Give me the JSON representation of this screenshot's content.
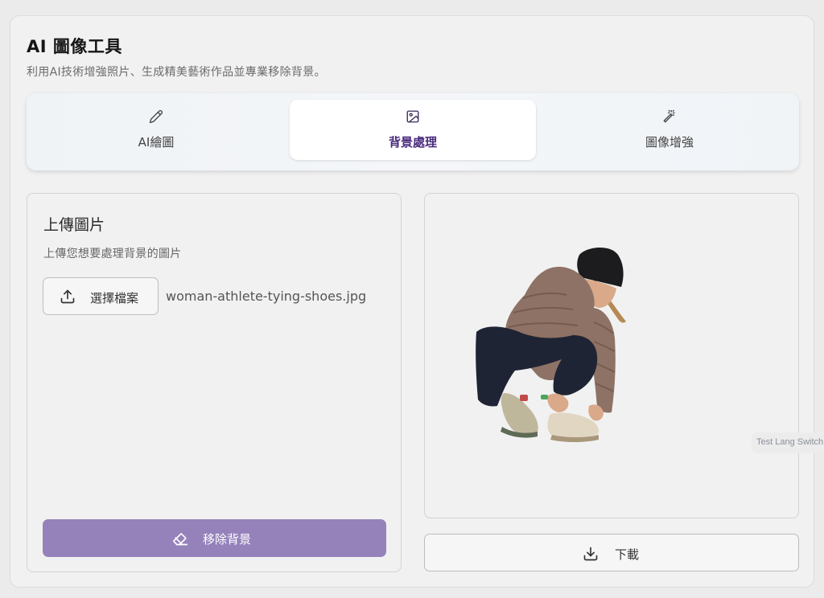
{
  "header": {
    "title": "AI 圖像工具",
    "subtitle": "利用AI技術增強照片、生成精美藝術作品並專業移除背景。"
  },
  "tabs": [
    {
      "label": "AI繪圖",
      "icon": "pencil-icon",
      "active": false
    },
    {
      "label": "背景處理",
      "icon": "image-icon",
      "active": true
    },
    {
      "label": "圖像增強",
      "icon": "magic-wand-icon",
      "active": false
    }
  ],
  "upload_panel": {
    "title": "上傳圖片",
    "description": "上傳您想要處理背景的圖片",
    "choose_file_label": "選擇檔案",
    "choose_file_icon": "upload-icon",
    "file_name": "woman-athlete-tying-shoes.jpg",
    "remove_bg_label": "移除背景",
    "remove_bg_icon": "eraser-icon",
    "remove_bg_color": "#9582bb"
  },
  "result_panel": {
    "image_icon": "result-image",
    "download_label": "下載",
    "download_icon": "download-icon"
  },
  "lang_switch": {
    "label": "Test Lang Switch"
  },
  "colors": {
    "accent": "#4a2a7c",
    "remove_button": "#9582bb"
  }
}
